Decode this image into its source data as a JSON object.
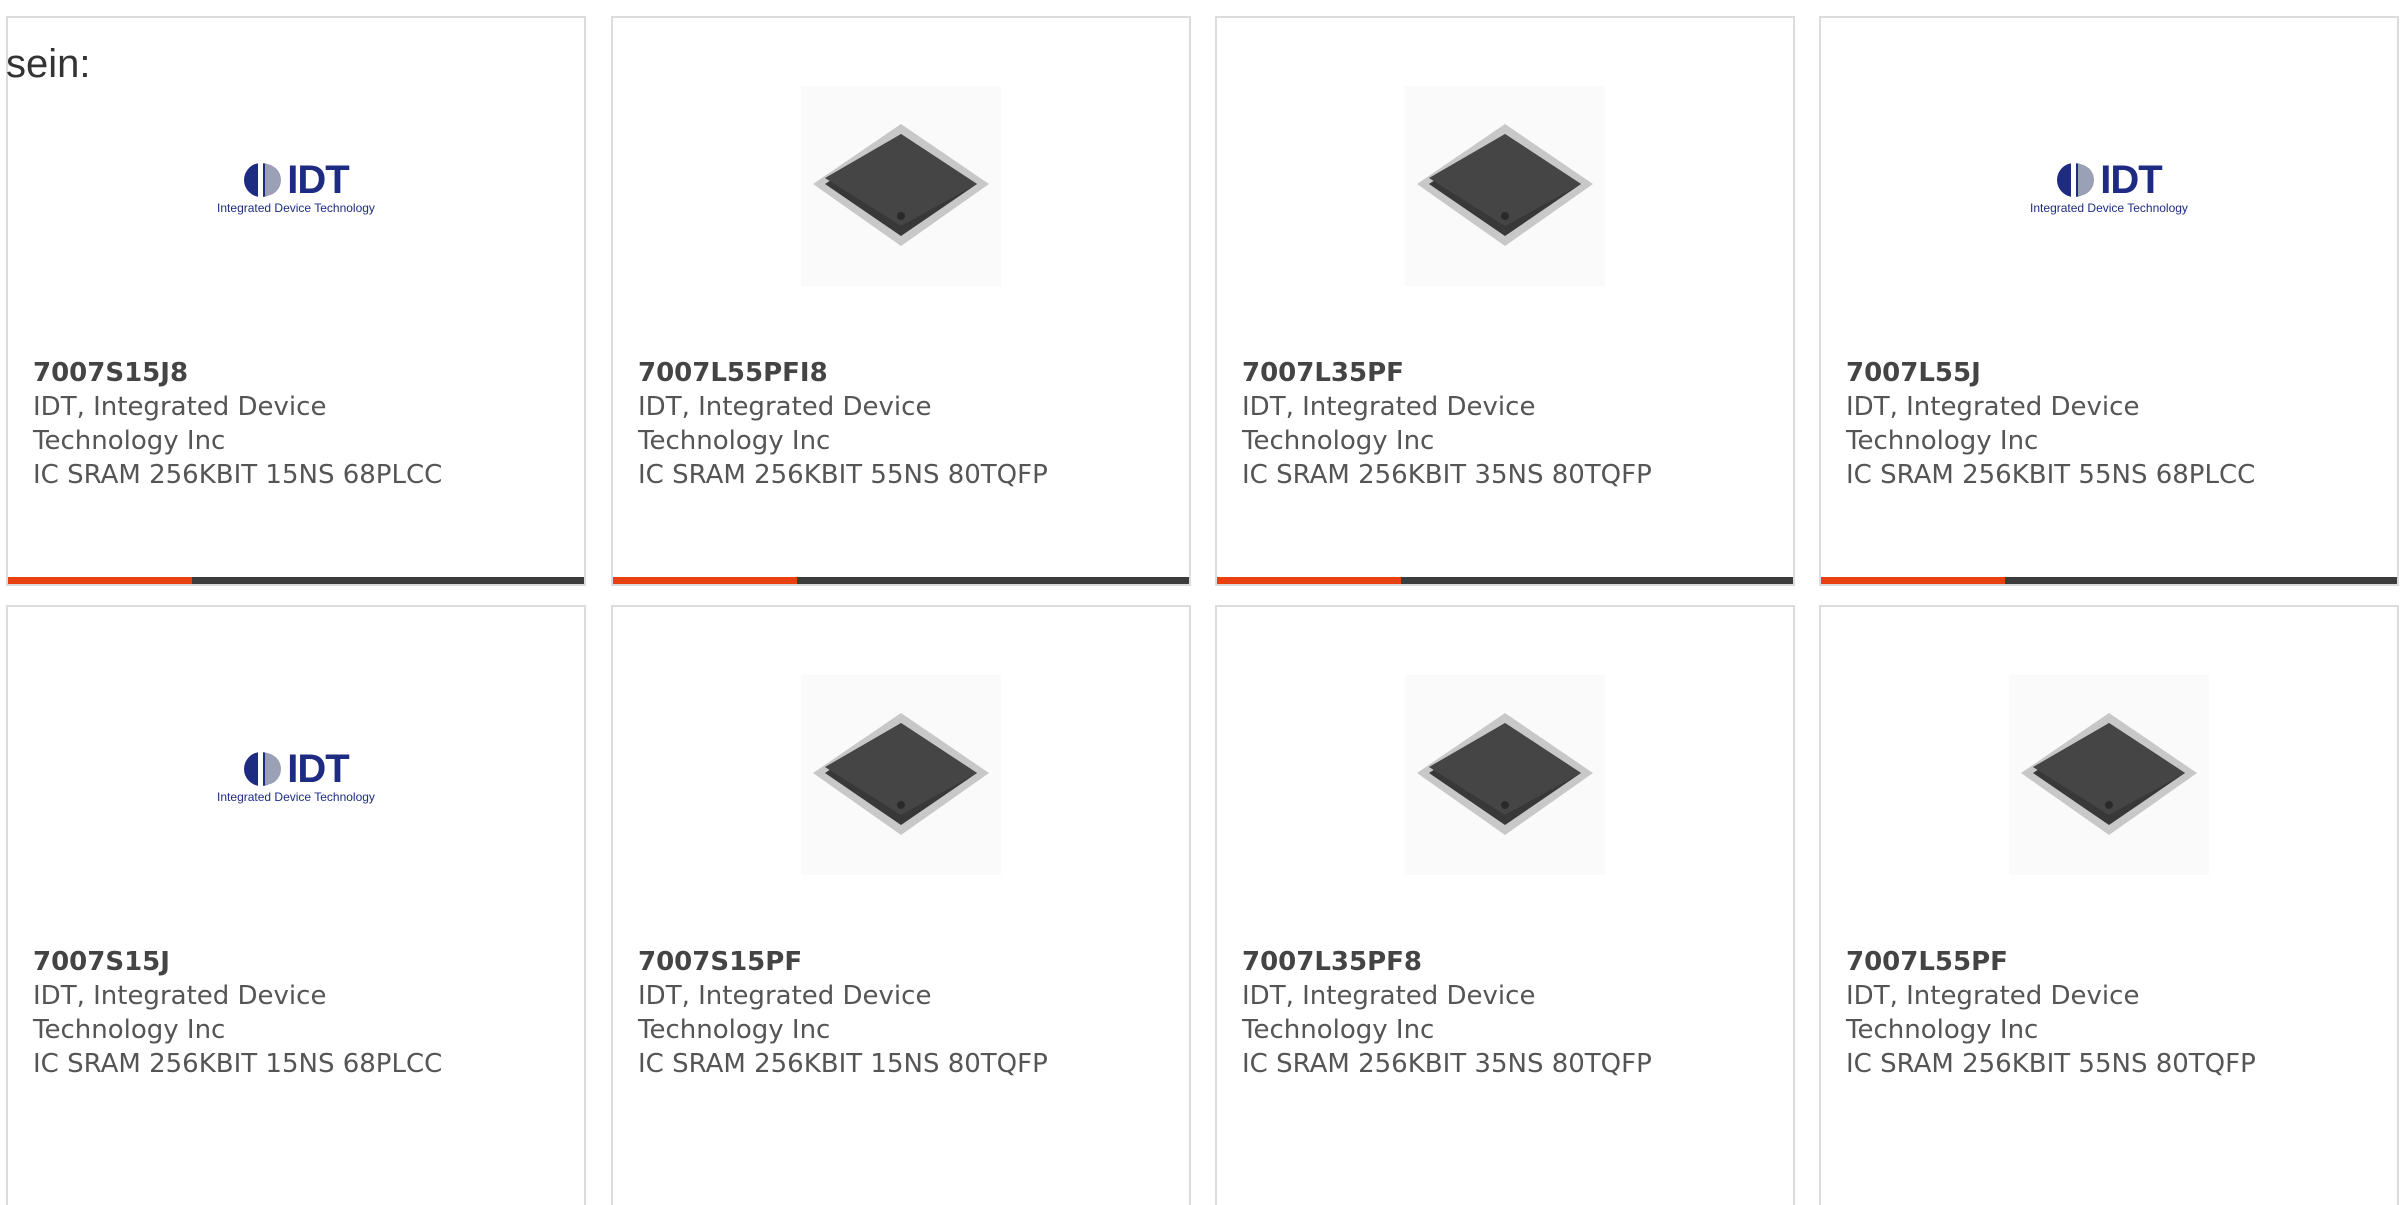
{
  "intro_text": "sein:",
  "colors": {
    "accent": "#e8410f",
    "bar": "#3c3c3c",
    "idt_blue": "#1d2b83"
  },
  "logo": {
    "word": "IDT",
    "tagline": "Integrated Device Technology"
  },
  "products": [
    {
      "part": "7007S15J8",
      "mfr_line1": "IDT, Integrated Device",
      "mfr_line2": "Technology Inc",
      "desc": "IC SRAM 256KBIT 15NS 68PLCC",
      "image": "idt-logo"
    },
    {
      "part": "7007L55PFI8",
      "mfr_line1": "IDT, Integrated Device",
      "mfr_line2": "Technology Inc",
      "desc": "IC SRAM 256KBIT 55NS 80TQFP",
      "image": "chip-photo"
    },
    {
      "part": "7007L35PF",
      "mfr_line1": "IDT, Integrated Device",
      "mfr_line2": "Technology Inc",
      "desc": "IC SRAM 256KBIT 35NS 80TQFP",
      "image": "chip-photo"
    },
    {
      "part": "7007L55J",
      "mfr_line1": "IDT, Integrated Device",
      "mfr_line2": "Technology Inc",
      "desc": "IC SRAM 256KBIT 55NS 68PLCC",
      "image": "idt-logo"
    },
    {
      "part": "7007S15J",
      "mfr_line1": "IDT, Integrated Device",
      "mfr_line2": "Technology Inc",
      "desc": "IC SRAM 256KBIT 15NS 68PLCC",
      "image": "idt-logo"
    },
    {
      "part": "7007S15PF",
      "mfr_line1": "IDT, Integrated Device",
      "mfr_line2": "Technology Inc",
      "desc": "IC SRAM 256KBIT 15NS 80TQFP",
      "image": "chip-photo"
    },
    {
      "part": "7007L35PF8",
      "mfr_line1": "IDT, Integrated Device",
      "mfr_line2": "Technology Inc",
      "desc": "IC SRAM 256KBIT 35NS 80TQFP",
      "image": "chip-photo"
    },
    {
      "part": "7007L55PF",
      "mfr_line1": "IDT, Integrated Device",
      "mfr_line2": "Technology Inc",
      "desc": "IC SRAM 256KBIT 55NS 80TQFP",
      "image": "chip-photo"
    }
  ]
}
